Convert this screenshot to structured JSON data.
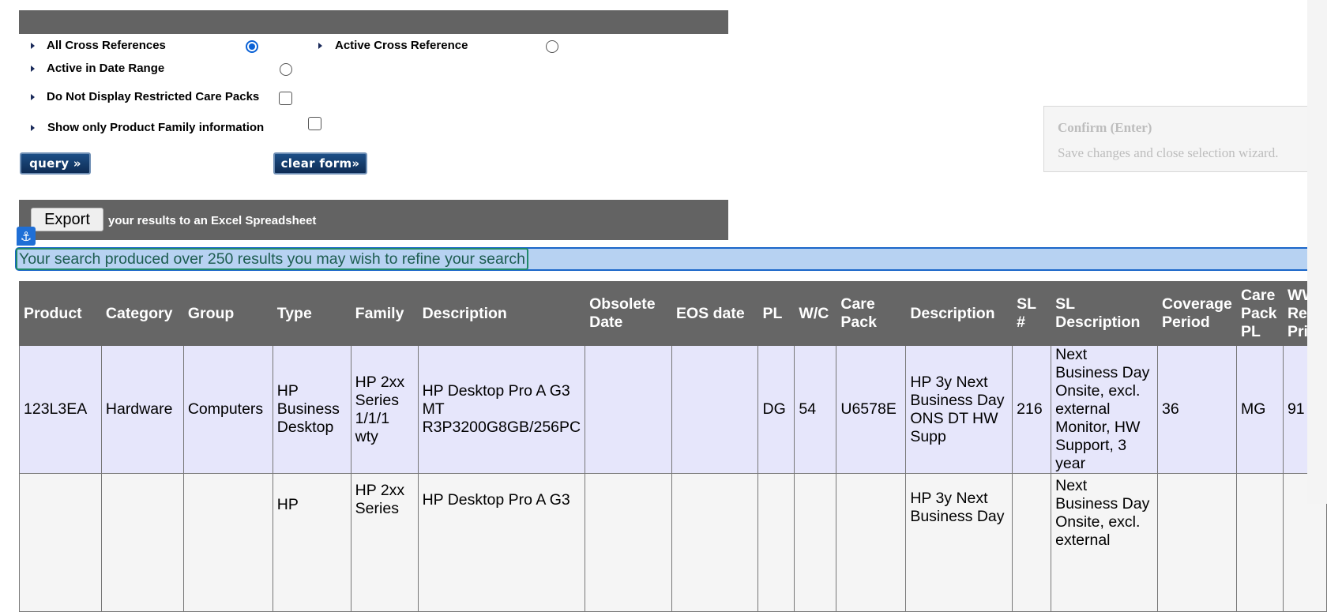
{
  "filters": {
    "all_cross_references": "All Cross References",
    "active_cross_reference": "Active Cross Reference",
    "active_in_date_range": "Active in Date Range",
    "no_restricted_care_packs": "Do Not Display Restricted Care Packs",
    "product_family_only": "Show only Product Family information",
    "selected_radio": "All Cross References"
  },
  "buttons": {
    "query": "query »",
    "clear_form": "clear form»",
    "export": "Export"
  },
  "export_bar": {
    "text": "your results to an Excel Spreadsheet"
  },
  "banner": {
    "text": "Your search produced over 250 results you may wish to refine your search"
  },
  "tooltip": {
    "title": "Confirm (Enter)",
    "subtitle": "Save changes and close selection wizard."
  },
  "table": {
    "headers": [
      "Product",
      "Category",
      "Group",
      "Type",
      "Family",
      "Description",
      "Obsolete Date",
      "EOS date",
      "PL",
      "W/C",
      "Care Pack",
      "Description",
      "SL #",
      "SL Description",
      "Coverage Period",
      "Care Pack PL",
      "WW Ref Pri"
    ],
    "rows": [
      [
        "123L3EA",
        "Hardware",
        "Computers",
        "HP Business Desktop",
        "HP 2xx Series 1/1/1 wty",
        "HP Desktop Pro A G3 MT R3P3200G8GB/256PC",
        "",
        "",
        "DG",
        "54",
        "U6578E",
        "HP 3y Next Business Day ONS DT HW Supp",
        "216",
        "Next Business Day Onsite, excl. external Monitor, HW Support, 3 year",
        "36",
        "MG",
        "91"
      ],
      [
        "",
        "",
        "",
        "HP",
        "HP 2xx Series",
        "HP Desktop Pro A G3",
        "",
        "",
        "",
        "",
        "",
        "HP 3y Next Business Day",
        "",
        "Next Business Day Onsite, excl. external",
        "",
        "",
        ""
      ]
    ]
  }
}
